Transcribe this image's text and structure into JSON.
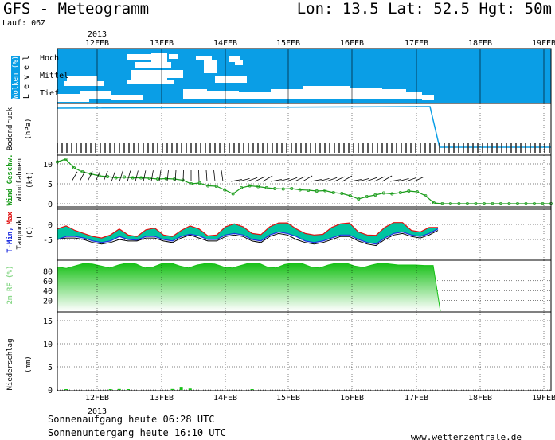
{
  "header": {
    "title": "GFS - Meteogramm",
    "location": "Lon: 13.5 Lat: 52.5 Hgt: 50m",
    "run": "Lauf: 06Z"
  },
  "footer": {
    "sunrise": "Sonnenaufgang heute 06:28 UTC",
    "sunset": "Sonnenuntergang heute 16:10 UTC",
    "site": "www.wetterzentrale.de"
  },
  "colors": {
    "cloud_bg": "#0a9ee6",
    "cloud": "#ffffff",
    "pressure": "#0a9ee6",
    "wind": "#1a9c1a",
    "temp_fill": "#00c4a0",
    "temp_max": "#e01010",
    "temp_min": "#2030e0",
    "humidity": "#16c016",
    "precip": "#16c016"
  },
  "chart_data": {
    "type": "line",
    "x_axis": {
      "year_label": "2013",
      "dates": [
        "12FEB",
        "13FEB",
        "14FEB",
        "15FEB",
        "16FEB",
        "17FEB",
        "18FEB",
        "19FEB"
      ]
    },
    "panels": [
      {
        "id": "clouds",
        "label": "Wolken (%)",
        "sublabel": "L e v e l",
        "levels": [
          "Hoch",
          "Mittel",
          "Tief"
        ]
      },
      {
        "id": "pressure",
        "label": "Bodendruck",
        "unit": "(hPa)"
      },
      {
        "id": "wind",
        "label": "Wind Geschw.",
        "sublabel": "Windfahnen",
        "unit": "(kt)",
        "y_ticks": [
          "10",
          "5",
          "0"
        ],
        "speed": [
          10.5,
          11.2,
          9,
          8,
          7.5,
          7,
          6.8,
          6.5,
          6.7,
          6.5,
          6.5,
          6.4,
          6.2,
          6.3,
          6.2,
          5.9,
          5,
          5.2,
          4.5,
          4.4,
          3.5,
          2.5,
          4,
          4.5,
          4.3,
          4,
          3.8,
          3.7,
          3.8,
          3.5,
          3.4,
          3.2,
          3.3,
          2.8,
          2.6,
          2,
          1.2,
          1.8,
          2.2,
          2.7,
          2.5,
          2.8,
          3.2,
          3,
          2,
          0.2,
          0,
          0,
          0,
          0,
          0,
          0,
          0,
          0,
          0,
          0,
          0,
          0,
          0,
          0
        ]
      },
      {
        "id": "temp",
        "label": "T-Min, Max",
        "label_tmin": "T-Min,",
        "label_tmax": "Max",
        "sublabel": "Taupunkt",
        "unit": "(C)",
        "y_ticks": [
          "0",
          "-5"
        ],
        "tmax": [
          -1.5,
          -0.5,
          -2,
          -3,
          -4,
          -4.5,
          -3.5,
          -1.5,
          -3.5,
          -4,
          -1.8,
          -1.2,
          -3.5,
          -4,
          -2,
          -0.5,
          -1.5,
          -3.8,
          -3.5,
          -0.8,
          0.2,
          -0.8,
          -3,
          -3.4,
          -0.8,
          0.5,
          0.5,
          -1.5,
          -3,
          -3.5,
          -3.3,
          -1,
          0.2,
          0.5,
          -2.5,
          -3.5,
          -3.6,
          -1,
          0.6,
          0.6,
          -2,
          -2.5,
          -1,
          -1
        ],
        "tmin": [
          -5,
          -4,
          -4,
          -4.5,
          -5.5,
          -6,
          -5.5,
          -4,
          -5,
          -5.2,
          -4,
          -4,
          -5,
          -5.5,
          -4,
          -3.2,
          -3.8,
          -5,
          -5,
          -3.5,
          -3,
          -3.5,
          -5,
          -5.5,
          -3.5,
          -2.5,
          -3,
          -4,
          -5.5,
          -6,
          -5.5,
          -4.5,
          -3.5,
          -3.5,
          -5,
          -6,
          -6.5,
          -4.5,
          -3,
          -2.5,
          -3.5,
          -4,
          -3,
          -1.5
        ],
        "dewpoint": [
          -5,
          -4.5,
          -4.5,
          -5,
          -6,
          -6.5,
          -6,
          -5,
          -5.5,
          -5.5,
          -4.5,
          -4.5,
          -5.5,
          -6,
          -4.5,
          -3.5,
          -4.5,
          -5.5,
          -5.5,
          -4,
          -3.5,
          -4,
          -5.5,
          -6,
          -4,
          -3,
          -3.5,
          -5,
          -6,
          -6.5,
          -6,
          -5,
          -4,
          -4,
          -5.5,
          -6.5,
          -7,
          -5,
          -3.5,
          -3,
          -4,
          -4.5,
          -3.5,
          -2
        ]
      },
      {
        "id": "humidity",
        "label": "2m RF (%)",
        "y_ticks": [
          "80",
          "60",
          "40",
          "20"
        ],
        "values": [
          88,
          85,
          90,
          95,
          94,
          90,
          86,
          92,
          96,
          94,
          86,
          88,
          95,
          96,
          90,
          86,
          92,
          95,
          94,
          88,
          86,
          91,
          96,
          96,
          88,
          86,
          93,
          96,
          95,
          88,
          86,
          92,
          96,
          96,
          90,
          87,
          92,
          96,
          94,
          92,
          92,
          92,
          91,
          91
        ]
      },
      {
        "id": "precip",
        "label": "Niederschlag",
        "unit": "(mm)",
        "y_ticks": [
          "15",
          "10",
          "5",
          "0"
        ],
        "values": [
          0,
          0.1,
          0,
          0,
          0,
          0,
          0.1,
          0.2,
          0.1,
          0,
          0,
          0,
          0,
          0.2,
          0.5,
          0.3,
          0,
          0,
          0,
          0,
          0,
          0,
          0.1,
          0,
          0,
          0,
          0,
          0,
          0,
          0,
          0,
          0,
          0,
          0,
          0,
          0,
          0,
          0,
          0,
          0,
          0,
          0,
          0,
          0
        ]
      }
    ]
  }
}
